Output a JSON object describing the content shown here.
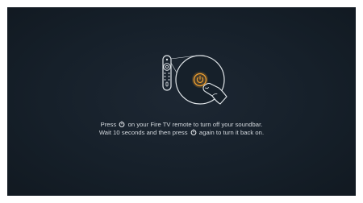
{
  "instructions": {
    "line1_before": "Press",
    "line1_after": "on your Fire TV remote to turn off your soundbar.",
    "line2_before": "Wait 10 seconds and then press",
    "line2_after": "again to turn it back on."
  },
  "icons": {
    "illustration": "remote-with-power-button-press",
    "inline": "power-icon"
  },
  "colors": {
    "background": "#16202a",
    "text": "#d6dbe0",
    "accent": "#f0a030"
  }
}
